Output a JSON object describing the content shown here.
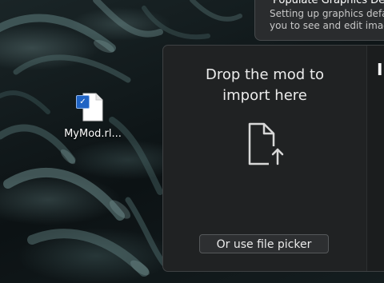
{
  "desktop": {
    "icon": {
      "label": "MyMod.rl...",
      "selected": true,
      "check_glyph": "✓",
      "icon": "file-icon"
    }
  },
  "notification": {
    "title": "Populate Graphics De",
    "body_line1": "Setting up graphics defau",
    "body_line2": "you to see and edit images"
  },
  "drop_window": {
    "title_line1": "Drop the mod to",
    "title_line2": "import here",
    "upload_icon": "file-upload-icon",
    "picker_label": "Or use file picker",
    "side_heading": "In"
  },
  "colors": {
    "window_bg": "#202223",
    "accent_check": "#1f63c4",
    "text": "#ececec"
  }
}
